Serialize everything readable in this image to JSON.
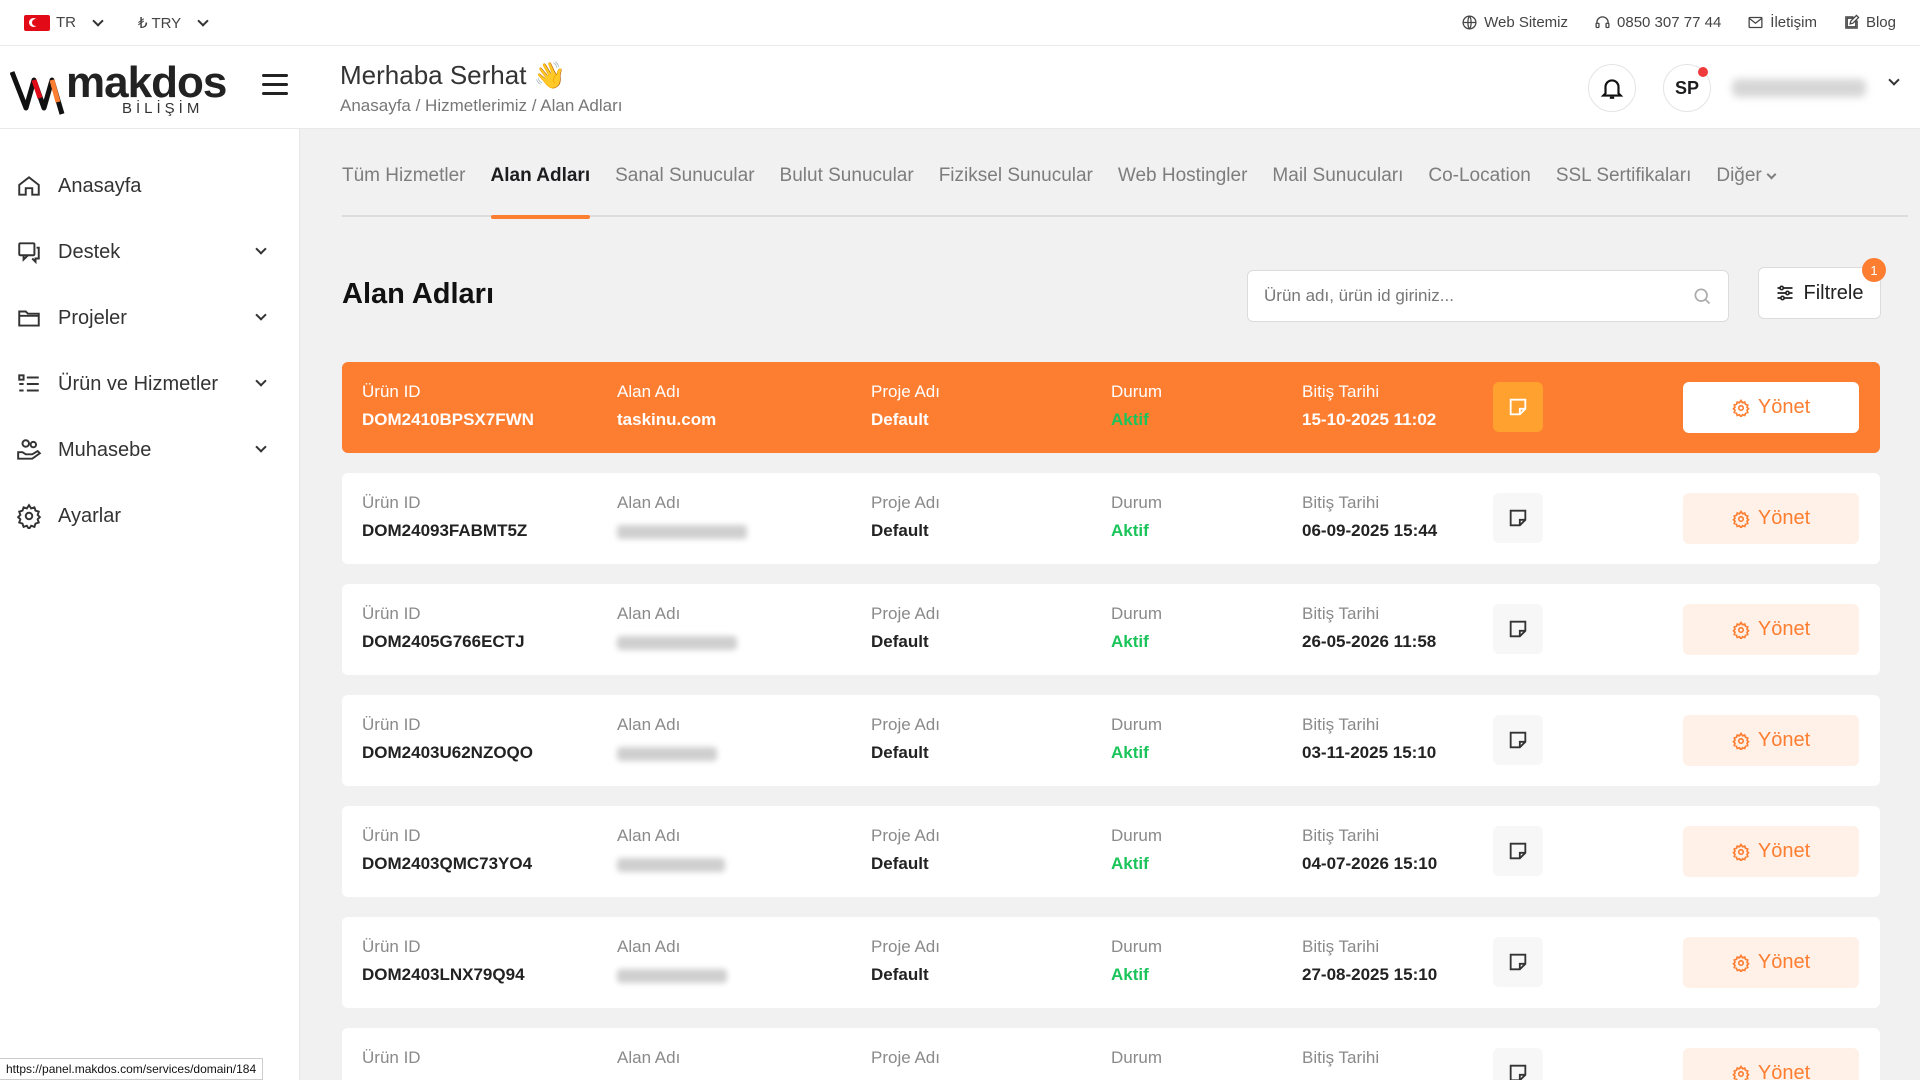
{
  "topbar": {
    "language": "TR",
    "currency": "₺ TRY",
    "links": [
      {
        "label": "Web Sitemiz",
        "icon": "globe-icon"
      },
      {
        "label": "0850 307 77 44",
        "icon": "headset-icon"
      },
      {
        "label": "İletişim",
        "icon": "mail-icon"
      },
      {
        "label": "Blog",
        "icon": "edit-icon"
      }
    ]
  },
  "brand": {
    "name": "makdos",
    "sub": "BİLİŞİM",
    "accent": "#fd7e31"
  },
  "header": {
    "greeting": "Merhaba Serhat 👋",
    "breadcrumb": "Anasayfa / Hizmetlerimiz / Alan Adları",
    "avatar_initials": "SP"
  },
  "sidebar": {
    "items": [
      {
        "label": "Anasayfa",
        "icon": "home-icon",
        "has_children": false
      },
      {
        "label": "Destek",
        "icon": "chat-icon",
        "has_children": true
      },
      {
        "label": "Projeler",
        "icon": "folder-icon",
        "has_children": true
      },
      {
        "label": "Ürün ve Hizmetler",
        "icon": "list-icon",
        "has_children": true
      },
      {
        "label": "Muhasebe",
        "icon": "money-hand-icon",
        "has_children": true
      },
      {
        "label": "Ayarlar",
        "icon": "gear-icon",
        "has_children": false
      }
    ]
  },
  "tabs": [
    {
      "label": "Tüm Hizmetler",
      "active": false
    },
    {
      "label": "Alan Adları",
      "active": true
    },
    {
      "label": "Sanal Sunucular",
      "active": false
    },
    {
      "label": "Bulut Sunucular",
      "active": false
    },
    {
      "label": "Fiziksel Sunucular",
      "active": false
    },
    {
      "label": "Web Hostingler",
      "active": false
    },
    {
      "label": "Mail Sunucuları",
      "active": false
    },
    {
      "label": "Co-Location",
      "active": false
    },
    {
      "label": "SSL Sertifikaları",
      "active": false
    },
    {
      "label": "Diğer",
      "active": false
    }
  ],
  "main": {
    "title": "Alan Adları",
    "search_placeholder": "Ürün adı, ürün id giriniz...",
    "filter_label": "Filtrele",
    "filter_count": "1",
    "columns": {
      "product_id": "Ürün ID",
      "domain": "Alan Adı",
      "project": "Proje Adı",
      "status": "Durum",
      "end_date": "Bitiş Tarihi"
    },
    "manage_label": "Yönet",
    "rows": [
      {
        "product_id": "DOM2410BPSX7FWN",
        "domain": "taskinu.com",
        "domain_blurred": false,
        "project": "Default",
        "status": "Aktif",
        "end_date": "15-10-2025 11:02",
        "highlight": true
      },
      {
        "product_id": "DOM24093FABMT5Z",
        "domain": "",
        "domain_blurred": true,
        "project": "Default",
        "status": "Aktif",
        "end_date": "06-09-2025 15:44",
        "highlight": false
      },
      {
        "product_id": "DOM2405G766ECTJ",
        "domain": "",
        "domain_blurred": true,
        "project": "Default",
        "status": "Aktif",
        "end_date": "26-05-2026 11:58",
        "highlight": false
      },
      {
        "product_id": "DOM2403U62NZOQO",
        "domain": "",
        "domain_blurred": true,
        "project": "Default",
        "status": "Aktif",
        "end_date": "03-11-2025 15:10",
        "highlight": false
      },
      {
        "product_id": "DOM2403QMC73YO4",
        "domain": "",
        "domain_blurred": true,
        "project": "Default",
        "status": "Aktif",
        "end_date": "04-07-2026 15:10",
        "highlight": false
      },
      {
        "product_id": "DOM2403LNX79Q94",
        "domain": "",
        "domain_blurred": true,
        "project": "Default",
        "status": "Aktif",
        "end_date": "27-08-2025 15:10",
        "highlight": false
      }
    ],
    "partial_row": true
  },
  "statusbar": {
    "url": "https://panel.makdos.com/services/domain/184"
  }
}
